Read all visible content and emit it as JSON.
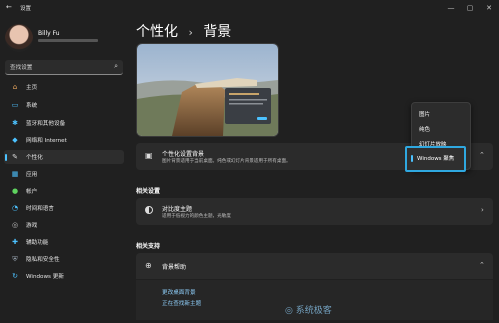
{
  "window": {
    "title": "设置",
    "controls": [
      "—",
      "▢",
      "✕"
    ]
  },
  "user": {
    "name": "Billy Fu",
    "email": ""
  },
  "search": {
    "placeholder": "查找设置"
  },
  "nav": [
    {
      "label": "主页",
      "icon": "home-icon",
      "color": "#e8a55d",
      "glyph": "⌂"
    },
    {
      "label": "系统",
      "icon": "monitor-icon",
      "color": "#4cc2ff",
      "glyph": "▭"
    },
    {
      "label": "蓝牙和其他设备",
      "icon": "bluetooth-icon",
      "color": "#4cc2ff",
      "glyph": "✱"
    },
    {
      "label": "网络和 Internet",
      "icon": "wifi-icon",
      "color": "#4cc2ff",
      "glyph": "◆"
    },
    {
      "label": "个性化",
      "icon": "brush-icon",
      "color": "#dcdcdc",
      "glyph": "✎"
    },
    {
      "label": "应用",
      "icon": "apps-icon",
      "color": "#4cc2ff",
      "glyph": "▦"
    },
    {
      "label": "帐户",
      "icon": "account-icon",
      "color": "#5fd35f",
      "glyph": "●"
    },
    {
      "label": "时间和语言",
      "icon": "globe-clock-icon",
      "color": "#4cc2ff",
      "glyph": "◔"
    },
    {
      "label": "游戏",
      "icon": "game-icon",
      "color": "#bdbdbd",
      "glyph": "◎"
    },
    {
      "label": "辅助功能",
      "icon": "accessibility-icon",
      "color": "#4cc2ff",
      "glyph": "✚"
    },
    {
      "label": "隐私和安全性",
      "icon": "shield-icon",
      "color": "#9aa6b2",
      "glyph": "⛨"
    },
    {
      "label": "Windows 更新",
      "icon": "update-icon",
      "color": "#4cc2ff",
      "glyph": "↻"
    }
  ],
  "breadcrumb": {
    "parent": "个性化",
    "separator": "›",
    "current": "背景"
  },
  "background_row": {
    "title": "个性化设置背景",
    "description": "图片背景适用于当前桌面。纯色或幻灯片背景适用于所有桌面。"
  },
  "dropdown": {
    "options": [
      "图片",
      "纯色",
      "幻灯片放映",
      "Windows 聚焦"
    ],
    "selected": "Windows 聚焦"
  },
  "related_settings": {
    "header": "相关设置",
    "contrast_title": "对比度主题",
    "contrast_desc": "适用于低视力的颜色主题，光敏度"
  },
  "related_support": {
    "header": "相关支持",
    "help_title": "背景帮助",
    "links": [
      "更改桌面背景",
      "正在查找新主题"
    ]
  },
  "watermark": "系统极客",
  "colors": {
    "accent": "#4cc2ff",
    "highlight_box": "#2fa8e0",
    "background": "#202020",
    "card": "#2b2b2b"
  }
}
